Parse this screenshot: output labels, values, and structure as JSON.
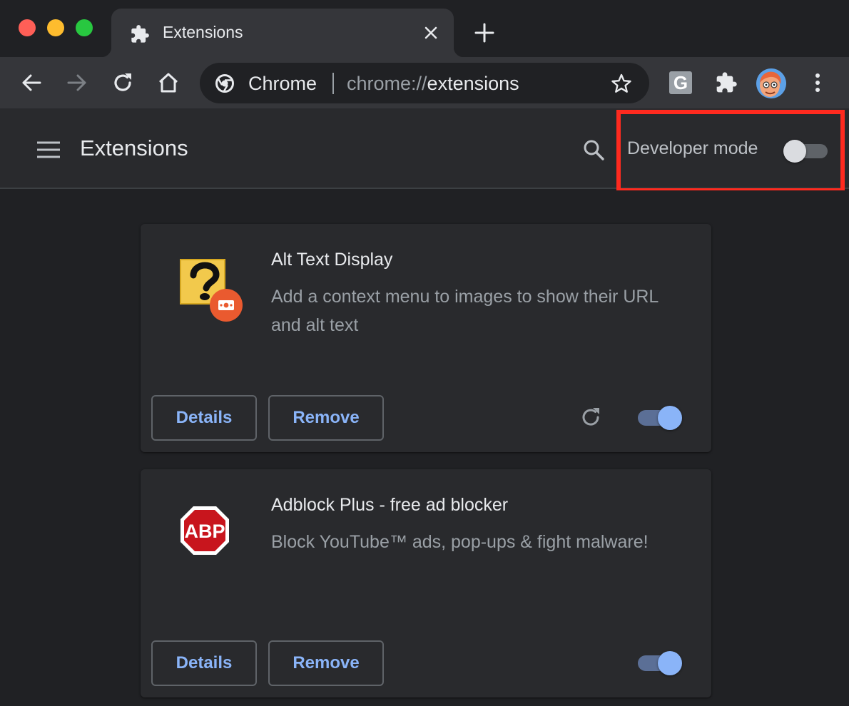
{
  "tab": {
    "title": "Extensions"
  },
  "omnibox": {
    "chip": "Chrome",
    "url_scheme": "chrome://",
    "url_host": "extensions"
  },
  "toolbar_icons": [
    "back-icon",
    "forward-icon",
    "reload-icon",
    "home-icon",
    "chrome-logo-icon",
    "bookmark-star-icon",
    "grammarly-extension-icon",
    "extensions-puzzle-icon",
    "profile-avatar",
    "more-menu-icon"
  ],
  "toolbar": {
    "grammarly_letter": "G"
  },
  "header": {
    "title": "Extensions",
    "developer_mode_label": "Developer mode",
    "developer_mode_on": false
  },
  "highlight_color": "#ff2a1f",
  "accent_color": "#8ab4f8",
  "extensions": [
    {
      "name": "Alt Text Display",
      "description": "Add a context menu to images to show their URL and alt text",
      "details_label": "Details",
      "remove_label": "Remove",
      "enabled": true,
      "show_reload": true,
      "icon": "question-mark-image-icon"
    },
    {
      "name": "Adblock Plus - free ad blocker",
      "description": "Block YouTube™ ads, pop-ups & fight malware!",
      "details_label": "Details",
      "remove_label": "Remove",
      "enabled": true,
      "show_reload": false,
      "icon": "abp-stop-sign-icon",
      "icon_text": "ABP"
    }
  ]
}
